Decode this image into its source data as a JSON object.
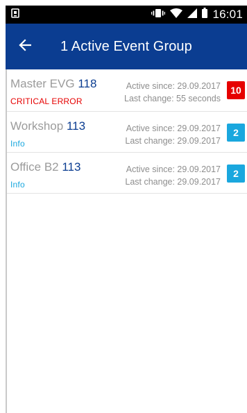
{
  "status_bar": {
    "time": "16:01",
    "icons": [
      "notification-icon",
      "vibrate-icon",
      "wifi-icon",
      "signal-icon",
      "battery-icon"
    ]
  },
  "app_bar": {
    "back_icon": "arrow-left-icon",
    "title": "1 Active Event Group"
  },
  "colors": {
    "app_bar": "#0b3d91",
    "critical": "#e60000",
    "info": "#1aa7de",
    "number": "#0b3d91"
  },
  "event_groups": [
    {
      "name": "Master EVG",
      "number": "118",
      "status": "CRITICAL ERROR",
      "status_color": "#e60000",
      "active_since": "Active since: 29.09.2017",
      "last_change": "Last change: 55 seconds",
      "badge": "10",
      "badge_color": "#e60000"
    },
    {
      "name": "Workshop",
      "number": "113",
      "status": "Info",
      "status_color": "#1aa7de",
      "active_since": "Active since: 29.09.2017",
      "last_change": "Last change: 29.09.2017",
      "badge": "2",
      "badge_color": "#1aa7de"
    },
    {
      "name": "Office B2",
      "number": "113",
      "status": "Info",
      "status_color": "#1aa7de",
      "active_since": "Active since: 29.09.2017",
      "last_change": "Last change: 29.09.2017",
      "badge": "2",
      "badge_color": "#1aa7de"
    }
  ]
}
